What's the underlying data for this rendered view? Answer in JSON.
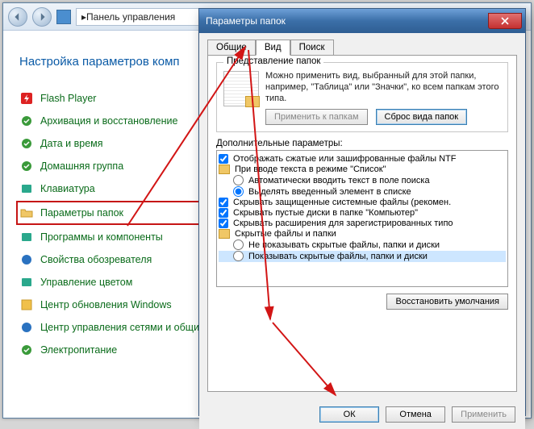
{
  "cp": {
    "breadcrumb": "Панель управления",
    "heading": "Настройка параметров комп",
    "items": [
      {
        "label": "Flash Player",
        "icon": "flash"
      },
      {
        "label": "Архивация и восстановление",
        "icon": "green"
      },
      {
        "label": "Дата и время",
        "icon": "green"
      },
      {
        "label": "Домашняя группа",
        "icon": "green"
      },
      {
        "label": "Клавиатура",
        "icon": "teal"
      },
      {
        "label": "Параметры папок",
        "icon": "folder",
        "hl": true
      },
      {
        "label": "Программы и компоненты",
        "icon": "teal"
      },
      {
        "label": "Свойства обозревателя",
        "icon": "blue"
      },
      {
        "label": "Управление цветом",
        "icon": "teal"
      },
      {
        "label": "Центр обновления Windows",
        "icon": "yellow"
      },
      {
        "label": "Центр управления сетями и общи",
        "icon": "blue"
      },
      {
        "label": "Электропитание",
        "icon": "green"
      }
    ]
  },
  "dlg": {
    "title": "Параметры папок",
    "tabs": [
      "Общие",
      "Вид",
      "Поиск"
    ],
    "active_tab": 1,
    "view_grp": "Представление папок",
    "view_desc": "Можно применить вид, выбранный для этой папки, например, \"Таблица\" или \"Значки\", ко всем папкам этого типа.",
    "apply_btn": "Применить к папкам",
    "reset_btn": "Сброс вида папок",
    "adv_label": "Дополнительные параметры:",
    "tree": [
      {
        "t": "chk",
        "ind": 0,
        "checked": true,
        "label": "Отображать сжатые или зашифрованные файлы NTF"
      },
      {
        "t": "grp",
        "ind": 0,
        "label": "При вводе текста в режиме \"Список\""
      },
      {
        "t": "rad",
        "ind": 1,
        "checked": false,
        "label": "Автоматически вводить текст в поле поиска"
      },
      {
        "t": "rad",
        "ind": 1,
        "checked": true,
        "label": "Выделять введенный элемент в списке"
      },
      {
        "t": "chk",
        "ind": 0,
        "checked": true,
        "label": "Скрывать защищенные системные файлы (рекомен."
      },
      {
        "t": "chk",
        "ind": 0,
        "checked": true,
        "label": "Скрывать пустые диски в папке \"Компьютер\""
      },
      {
        "t": "chk",
        "ind": 0,
        "checked": true,
        "label": "Скрывать расширения для зарегистрированных типо"
      },
      {
        "t": "grp",
        "ind": 0,
        "label": "Скрытые файлы и папки"
      },
      {
        "t": "rad",
        "ind": 1,
        "checked": false,
        "label": "Не показывать скрытые файлы, папки и диски"
      },
      {
        "t": "rad",
        "ind": 1,
        "checked": false,
        "label": "Показывать скрытые файлы, папки и диски",
        "sel": true
      }
    ],
    "restore": "Восстановить умолчания",
    "ok": "ОК",
    "cancel": "Отмена",
    "apply": "Применить"
  }
}
